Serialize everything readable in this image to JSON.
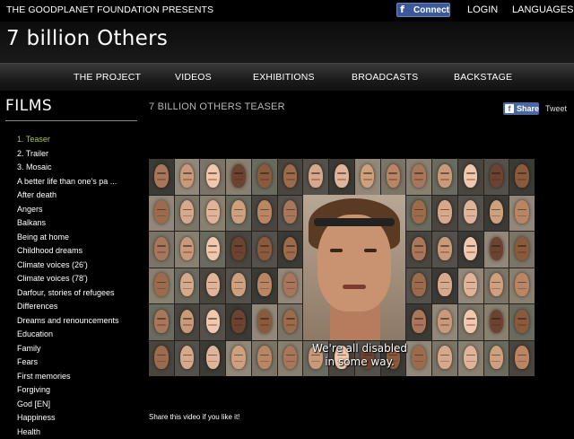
{
  "topbar": {
    "presents": "THE GOODPLANET FOUNDATION PRESENTS",
    "connect_label": "Connect",
    "login_label": "LOGIN",
    "languages_label": "LANGUAGES"
  },
  "header": {
    "site_title": "7 billion Others"
  },
  "nav": {
    "items": [
      "THE PROJECT",
      "VIDEOS",
      "EXHIBITIONS",
      "BROADCASTS",
      "BACKSTAGE"
    ]
  },
  "sidebar": {
    "title": "FILMS",
    "films": [
      "1. Teaser",
      "2. Trailer",
      "3. Mosaic",
      "A better life than one's pa ...",
      "After death",
      "Angers",
      "Balkans",
      "Being at home",
      "Childhood dreams",
      "Climate voices (26')",
      "Climate voices (78')",
      "Darfour, stories of refugees",
      "Differences",
      "Dreams and renouncements",
      "Education",
      "Family",
      "Fears",
      "First memories",
      "Forgiving",
      "God [EN]",
      "Happiness",
      "Health"
    ],
    "active_index": 0
  },
  "main": {
    "video_title": "7 BILLION OTHERS TEASER",
    "share_label": "Share",
    "tweet_label": "Tweet",
    "subtitle_line1": "We're all disabled",
    "subtitle_line2": "in some way.",
    "share_text": "Share this video if you like it!"
  },
  "colors": {
    "active_film": "#a9c24e",
    "facebook_blue": "#3b5998"
  }
}
